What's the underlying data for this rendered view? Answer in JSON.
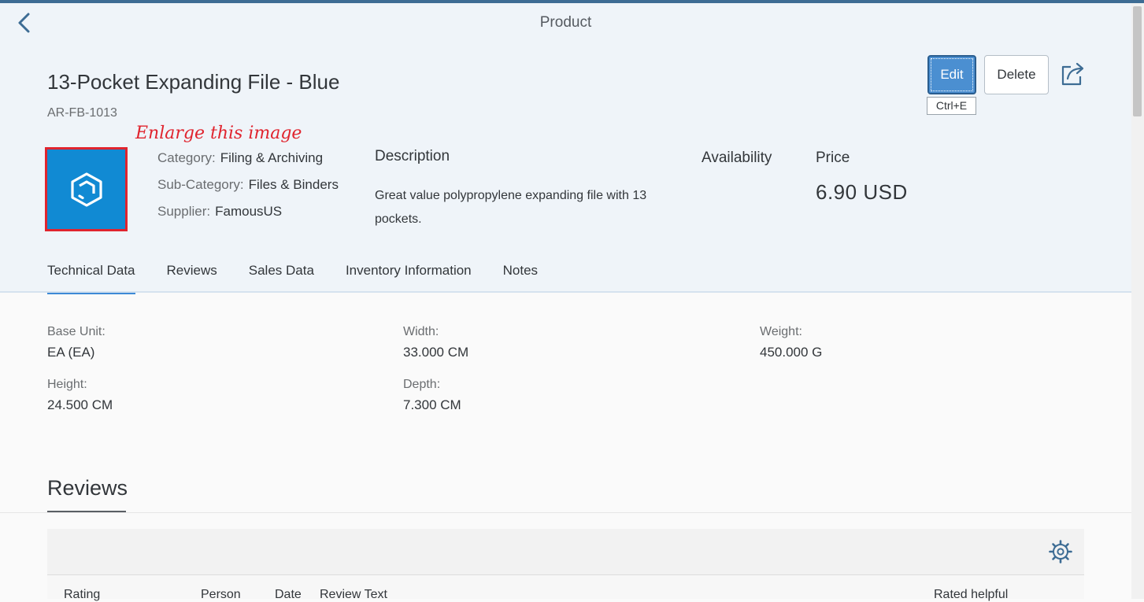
{
  "header": {
    "title": "Product",
    "back_icon": "chevron-left-icon"
  },
  "object": {
    "title": "13-Pocket Expanding File - Blue",
    "id": "AR-FB-1013",
    "image_annotation": "Enlarge this image",
    "image_icon": "product-cube-icon",
    "image_bg": "#118ad3",
    "category_label": "Category:",
    "category": "Filing & Archiving",
    "subcategory_label": "Sub-Category:",
    "subcategory": "Files & Binders",
    "supplier_label": "Supplier:",
    "supplier": "FamousUS",
    "description_label": "Description",
    "description": "Great value polypropylene expanding file with 13 pockets.",
    "availability_label": "Availability",
    "price_label": "Price",
    "price": "6.90  USD"
  },
  "actions": {
    "edit_label": "Edit",
    "edit_tooltip": "Ctrl+E",
    "delete_label": "Delete",
    "share_icon": "share-icon"
  },
  "tabs": [
    {
      "label": "Technical Data",
      "active": true
    },
    {
      "label": "Reviews"
    },
    {
      "label": "Sales Data"
    },
    {
      "label": "Inventory Information"
    },
    {
      "label": "Notes"
    }
  ],
  "technical": {
    "base_unit_label": "Base Unit:",
    "base_unit": "EA (EA)",
    "width_label": "Width:",
    "width": "33.000 CM",
    "weight_label": "Weight:",
    "weight": "450.000 G",
    "height_label": "Height:",
    "height": "24.500 CM",
    "depth_label": "Depth:",
    "depth": "7.300 CM"
  },
  "reviews": {
    "title": "Reviews",
    "settings_icon": "gear-icon",
    "columns": [
      "Rating",
      "Person",
      "Date",
      "Review Text",
      "Rated helpful"
    ]
  },
  "colors": {
    "accent": "#3d8ad6",
    "annotation": "#e0242e",
    "header_bg": "#eff4f9"
  }
}
